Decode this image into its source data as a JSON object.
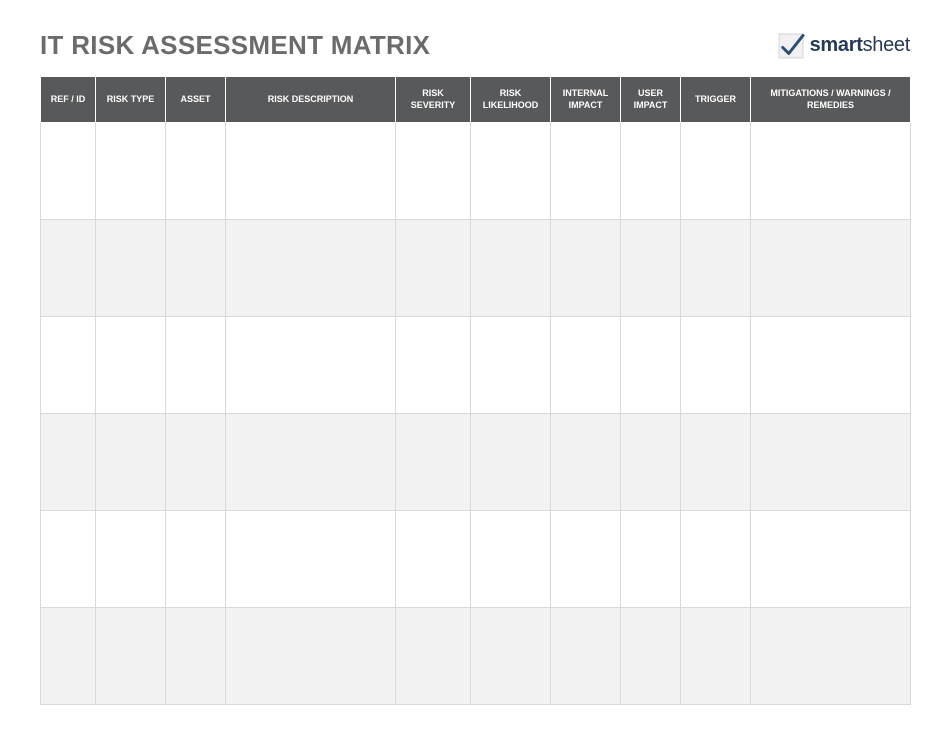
{
  "title": "IT RISK ASSESSMENT MATRIX",
  "logo": {
    "brand_bold": "smart",
    "brand_light": "sheet"
  },
  "columns": [
    "REF / ID",
    "RISK TYPE",
    "ASSET",
    "RISK DESCRIPTION",
    "RISK SEVERITY",
    "RISK LIKELIHOOD",
    "INTERNAL IMPACT",
    "USER IMPACT",
    "TRIGGER",
    "MITIGATIONS / WARNINGS / REMEDIES"
  ],
  "rows": [
    [
      "",
      "",
      "",
      "",
      "",
      "",
      "",
      "",
      "",
      ""
    ],
    [
      "",
      "",
      "",
      "",
      "",
      "",
      "",
      "",
      "",
      ""
    ],
    [
      "",
      "",
      "",
      "",
      "",
      "",
      "",
      "",
      "",
      ""
    ],
    [
      "",
      "",
      "",
      "",
      "",
      "",
      "",
      "",
      "",
      ""
    ],
    [
      "",
      "",
      "",
      "",
      "",
      "",
      "",
      "",
      "",
      ""
    ],
    [
      "",
      "",
      "",
      "",
      "",
      "",
      "",
      "",
      "",
      ""
    ]
  ]
}
